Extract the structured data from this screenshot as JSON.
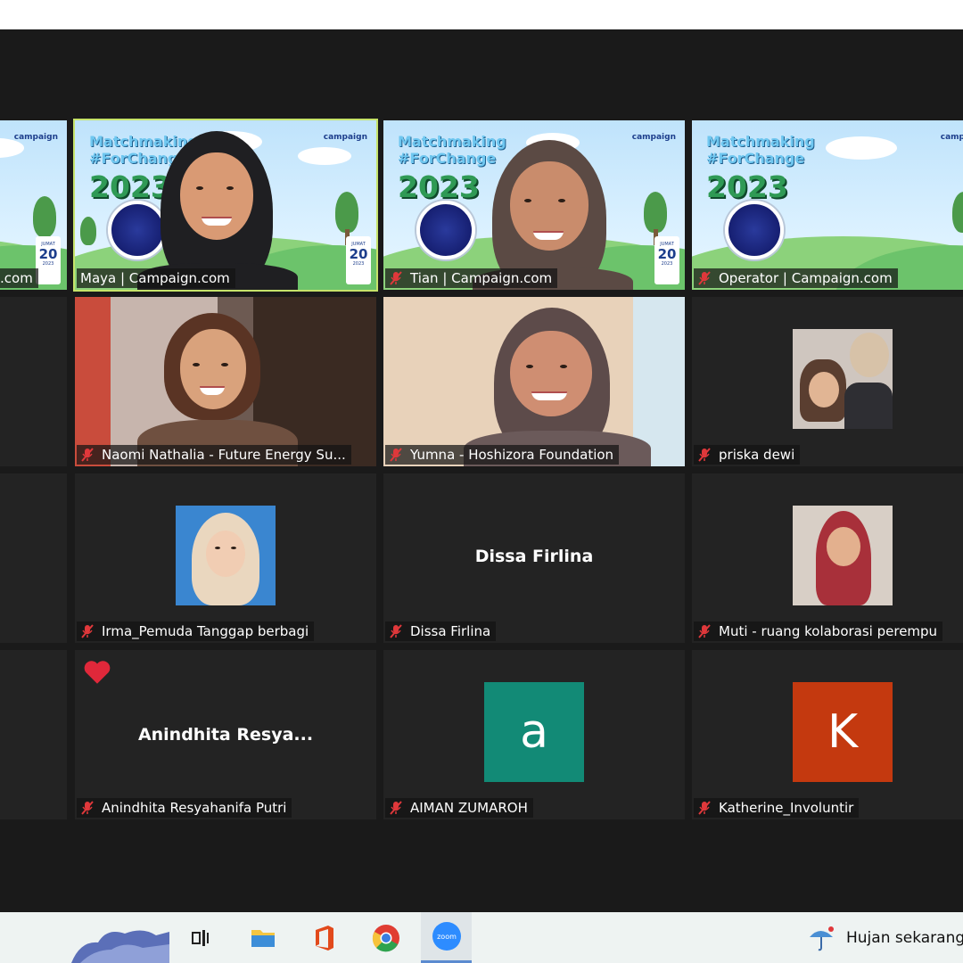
{
  "banner": {
    "title": "Matchmaking\n#ForChange",
    "year": "2023",
    "logo": "campaign",
    "date_day": "JUMAT",
    "date_num": "20",
    "date_month": "JANUARI",
    "date_year": "2023"
  },
  "participants": {
    "left_partial_1": ".com",
    "maya": "Maya | Campaign.com",
    "tian": "Tian | Campaign.com",
    "operator": "Operator | Campaign.com",
    "naomi": "Naomi Nathalia - Future Energy Su...",
    "yumna": "Yumna - Hoshizora Foundation",
    "priska": "priska dewi",
    "irma": "Irma_Pemuda Tanggap berbagi",
    "dissa": "Dissa Firlina",
    "dissa_center": "Dissa Firlina",
    "muti": "Muti - ruang kolaborasi perempu",
    "anindhita": "Anindhita Resyahanifa Putri",
    "anindhita_center": "Anindhita  Resya...",
    "aiman": "AIMAN ZUMAROH",
    "aiman_letter": "a",
    "katherine": "Katherine_Involuntir",
    "katherine_letter": "K"
  },
  "colors": {
    "active_speaker": "#c6e36a",
    "mic_muted": "#e0383b",
    "aiman_avatar": "#128a76",
    "katherine_avatar": "#c4390f"
  },
  "taskbar": {
    "apps": [
      "task-view-icon",
      "file-explorer-icon",
      "office-icon",
      "chrome-icon",
      "zoom-icon"
    ],
    "zoom_label": "zoom",
    "weather_text": "Hujan sekarang"
  }
}
